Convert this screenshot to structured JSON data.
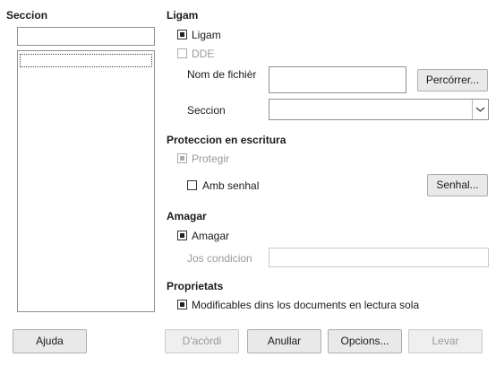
{
  "left": {
    "title": "Seccion",
    "filter_value": "",
    "list_items": [
      ""
    ]
  },
  "link": {
    "title": "Ligam",
    "link_checkbox": "Ligam",
    "link_checked": true,
    "dde_checkbox": "DDE",
    "dde_checked": false,
    "filename_label": "Nom de fichièr",
    "filename_value": "",
    "browse_button": "Percórrer...",
    "section_label": "Seccion",
    "section_value": ""
  },
  "protection": {
    "title": "Proteccion en escritura",
    "protect_checkbox": "Protegir",
    "protect_checked": true,
    "password_checkbox": "Amb senhal",
    "password_checked": false,
    "password_button": "Senhal..."
  },
  "hide": {
    "title": "Amagar",
    "hide_checkbox": "Amagar",
    "hide_checked": true,
    "condition_label": "Jos condicion",
    "condition_value": ""
  },
  "properties": {
    "title": "Proprietats",
    "editable_checkbox": "Modificables dins los documents en lectura sola",
    "editable_checked": true
  },
  "footer": {
    "help": "Ajuda",
    "ok": "D'acòrdi",
    "cancel": "Anullar",
    "options": "Opcions...",
    "remove": "Levar"
  },
  "colors": {
    "text": "#1a1a1a",
    "disabled": "#9a9a9a",
    "button_face": "#e9e9e9"
  }
}
